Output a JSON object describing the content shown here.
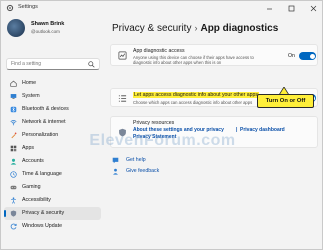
{
  "window": {
    "title": "Settings"
  },
  "profile": {
    "name": "Shawn Brink",
    "email": "@outlook.com"
  },
  "search": {
    "placeholder": "Find a setting"
  },
  "nav": [
    {
      "label": "Home",
      "icon": "home-icon"
    },
    {
      "label": "System",
      "icon": "system-icon"
    },
    {
      "label": "Bluetooth & devices",
      "icon": "bluetooth-icon"
    },
    {
      "label": "Network & internet",
      "icon": "network-icon"
    },
    {
      "label": "Personalization",
      "icon": "personalization-icon"
    },
    {
      "label": "Apps",
      "icon": "apps-icon"
    },
    {
      "label": "Accounts",
      "icon": "accounts-icon"
    },
    {
      "label": "Time & language",
      "icon": "time-language-icon"
    },
    {
      "label": "Gaming",
      "icon": "gaming-icon"
    },
    {
      "label": "Accessibility",
      "icon": "accessibility-icon"
    },
    {
      "label": "Privacy & security",
      "icon": "privacy-icon",
      "active": true
    },
    {
      "label": "Windows Update",
      "icon": "windows-update-icon"
    }
  ],
  "breadcrumb": {
    "parent": "Privacy & security",
    "separator": "›",
    "current": "App diagnostics"
  },
  "access_card": {
    "title": "App diagnostic access",
    "description": "Anyone using this device can choose if their apps have access to diagnostic info about other apps when this is on",
    "toggle_label": "On",
    "toggle_on": true
  },
  "apps_card": {
    "title": "Let apps access diagnostic info about your other apps",
    "description": "Choose which apps can access diagnostic info about other apps",
    "toggle_label": "On",
    "toggle_on": true
  },
  "resources": {
    "title": "Privacy resources",
    "links": [
      "About these settings and your privacy",
      "Privacy dashboard",
      "Privacy Statement"
    ]
  },
  "help": [
    {
      "label": "Get help",
      "icon": "help-icon"
    },
    {
      "label": "Give feedback",
      "icon": "feedback-icon"
    }
  ],
  "callout": {
    "text": "Turn On or Off"
  },
  "watermark": {
    "text": "ElevenForum.com"
  },
  "colors": {
    "accent": "#0067c0",
    "highlight": "#ffef3a",
    "link": "#0a4fa8"
  }
}
